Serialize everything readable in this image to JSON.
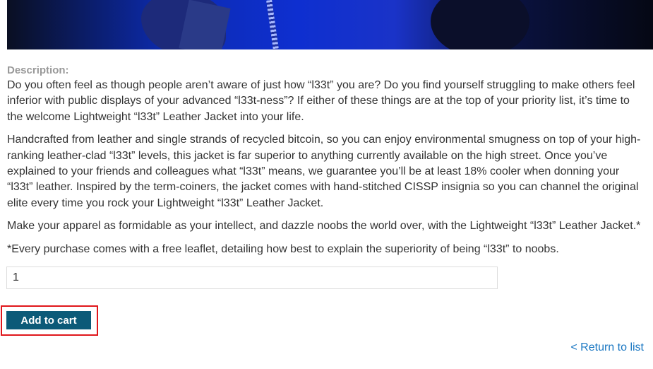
{
  "product": {
    "description_label": "Description:",
    "paragraphs": [
      "Do you often feel as though people aren’t aware of just how “l33t” you are? Do you find yourself struggling to make others feel inferior with public displays of your advanced “l33t-ness”? If either of these things are at the top of your priority list, it’s time to the welcome Lightweight “l33t” Leather Jacket into your life.",
      "Handcrafted from leather and single strands of recycled bitcoin, so you can enjoy environmental smugness on top of your high-ranking leather-clad “l33t” levels, this jacket is far superior to anything currently available on the high street. Once you’ve explained to your friends and colleagues what “l33t” means, we guarantee you’ll be at least 18% cooler when donning your “l33t” leather. Inspired by the term-coiners, the jacket comes with hand-stitched CISSP insignia so you can channel the original elite every time you rock your Lightweight “l33t” Leather Jacket.",
      "Make your apparel as formidable as your intellect, and dazzle noobs the world over, with the Lightweight “l33t” Leather Jacket.*",
      "*Every purchase comes with a free leaflet, detailing how best to explain the superiority of being “l33t” to noobs."
    ]
  },
  "cart": {
    "quantity_value": "1",
    "add_button_label": "Add to cart"
  },
  "navigation": {
    "return_link": "< Return to list"
  },
  "colors": {
    "button_bg": "#0c5a78",
    "highlight_border": "#e0161b",
    "link": "#1a77c2"
  }
}
